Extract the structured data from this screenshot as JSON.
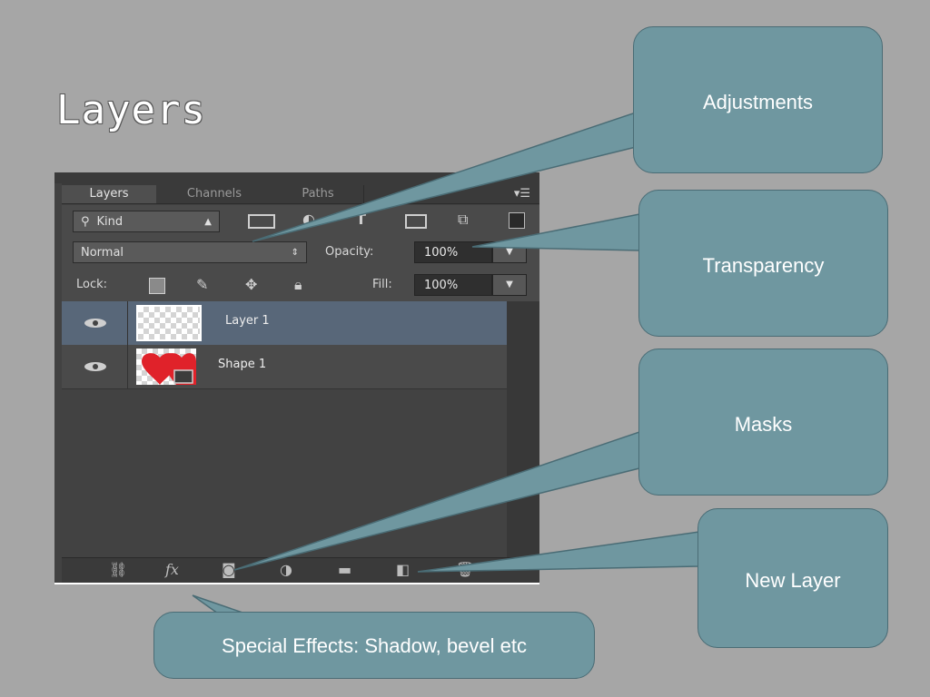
{
  "slide": {
    "title": "Layers"
  },
  "panel": {
    "tabs": [
      "Layers",
      "Channels",
      "Paths"
    ],
    "menu_icon": "panel-menu-icon",
    "filter": {
      "kind_label": "Kind",
      "icons": [
        "image-filter-icon",
        "adjustment-filter-icon",
        "type-filter-icon",
        "shape-filter-icon",
        "smart-object-filter-icon",
        "filter-toggle-icon"
      ]
    },
    "blend_mode": "Normal",
    "opacity_label": "Opacity:",
    "opacity_value": "100%",
    "lock_label": "Lock:",
    "fill_label": "Fill:",
    "fill_value": "100%",
    "layers": [
      {
        "name": "Layer 1",
        "selected": true,
        "thumbnail": "transparent-checker"
      },
      {
        "name": "Shape 1",
        "selected": false,
        "thumbnail": "red-heart-shape"
      }
    ],
    "bottom_icons": [
      "link-layers-icon",
      "fx-icon",
      "add-mask-icon",
      "adjustment-layer-icon",
      "group-folder-icon",
      "new-layer-icon",
      "delete-layer-icon"
    ]
  },
  "callouts": {
    "adjustments": "Adjustments",
    "transparency": "Transparency",
    "masks": "Masks",
    "new_layer": "New Layer",
    "special_effects": "Special Effects: Shadow, bevel etc"
  },
  "colors": {
    "background": "#a6a6a6",
    "callout_fill": "#6f97a0",
    "selected_layer": "#586779",
    "heart": "#e0222a"
  }
}
